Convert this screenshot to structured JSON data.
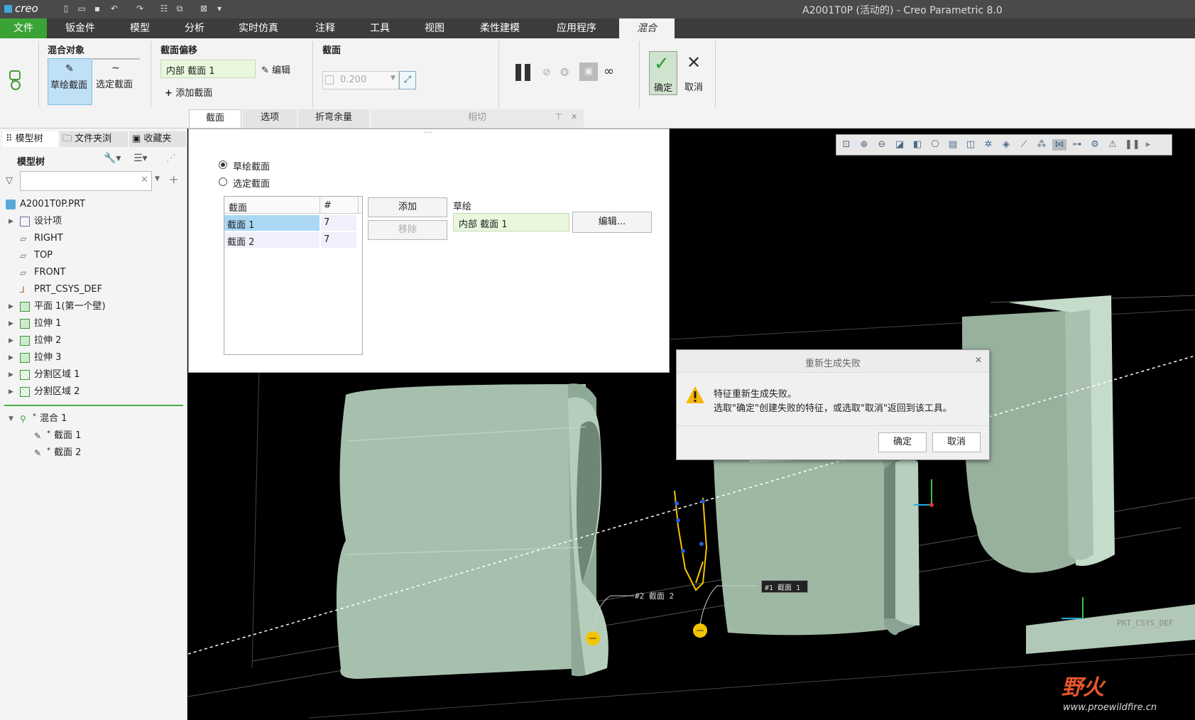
{
  "app": {
    "logo": "creo",
    "window_title": "A2001T0P (活动的) - Creo Parametric 8.0"
  },
  "menu": {
    "tabs": [
      "文件",
      "钣金件",
      "模型",
      "分析",
      "实时仿真",
      "注释",
      "工具",
      "视图",
      "柔性建模",
      "应用程序",
      "混合"
    ]
  },
  "ribbon": {
    "blend_objects_label": "混合对象",
    "sketch_section_btn": "草绘截面",
    "select_section_btn": "选定截面",
    "section_offset_label": "截面偏移",
    "section_offset_value": "内部 截面 1",
    "edit_label": "编辑",
    "add_section_label": "添加截面",
    "section_label": "截面",
    "section_value": "0.200",
    "ok_label": "确定",
    "cancel_label": "取消",
    "subtabs": [
      "截面",
      "选项",
      "折弯余量",
      "相切"
    ]
  },
  "left_panel": {
    "tabs": [
      "模型树",
      "文件夹浏",
      "收藏夹"
    ],
    "tree_header": "模型树",
    "items": [
      {
        "label": "A2001T0P.PRT"
      },
      {
        "label": "设计项"
      },
      {
        "label": "RIGHT"
      },
      {
        "label": "TOP"
      },
      {
        "label": "FRONT"
      },
      {
        "label": "PRT_CSYS_DEF"
      },
      {
        "label": "平面 1(第一个壁)"
      },
      {
        "label": "拉伸 1"
      },
      {
        "label": "拉伸 2"
      },
      {
        "label": "拉伸 3"
      },
      {
        "label": "分割区域 1"
      },
      {
        "label": "分割区域 2"
      },
      {
        "label": "混合 1"
      },
      {
        "label": "截面 1"
      },
      {
        "label": "截面 2"
      }
    ],
    "new_marker": "*"
  },
  "section_panel": {
    "radio_sketch": "草绘截面",
    "radio_select": "选定截面",
    "col_section": "截面",
    "col_count": "#",
    "rows": [
      {
        "name": "截面 1",
        "count": "7"
      },
      {
        "name": "截面 2",
        "count": "7"
      }
    ],
    "add_btn": "添加",
    "remove_btn": "移除",
    "sketch_label": "草绘",
    "sketch_value": "内部 截面 1",
    "edit_btn": "编辑..."
  },
  "dialog": {
    "title": "重新生成失败",
    "line1": "特征重新生成失败。",
    "line2": "选取\"确定\"创建失败的特征，或选取\"取消\"返回到该工具。",
    "ok": "确定",
    "cancel": "取消"
  },
  "viewport": {
    "tag_section2": "#2 截面 2",
    "tag_section1": "#1 截面 1",
    "csys_label": "PRT_CSYS_DEF",
    "watermark_cn": "野火",
    "watermark_url": "www.proewildfire.cn"
  },
  "colors": {
    "accent_green": "#3aa335",
    "model": "#9fb8a3",
    "selection_yellow": "#f5c400"
  }
}
